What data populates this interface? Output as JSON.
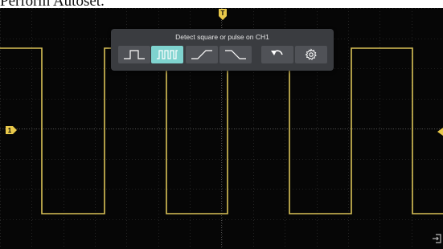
{
  "caption": "Perform Autoset.",
  "autoset_panel": {
    "title": "Detect square or pulse on CH1",
    "buttons": [
      {
        "icon": "square-wave-icon",
        "label": "Square",
        "active": false
      },
      {
        "icon": "pulse-train-icon",
        "label": "Pulse",
        "active": true
      },
      {
        "icon": "rising-edge-icon",
        "label": "Rising Edge",
        "active": false
      },
      {
        "icon": "falling-edge-icon",
        "label": "Falling Edge",
        "active": false
      },
      {
        "icon": "undo-icon",
        "label": "Undo",
        "active": false
      },
      {
        "icon": "gear-icon",
        "label": "Settings",
        "active": false
      }
    ]
  },
  "channel_marker": {
    "label": "1",
    "color": "#e8c84a"
  },
  "trigger_marker": {
    "label": "T",
    "color": "#e8c84a"
  },
  "exit_icon": "exit-icon",
  "colors": {
    "trace": "#d9c157",
    "grid": "#3a3a3a",
    "panel": "#3a3c40",
    "active_button": "#7fd3cf"
  }
}
